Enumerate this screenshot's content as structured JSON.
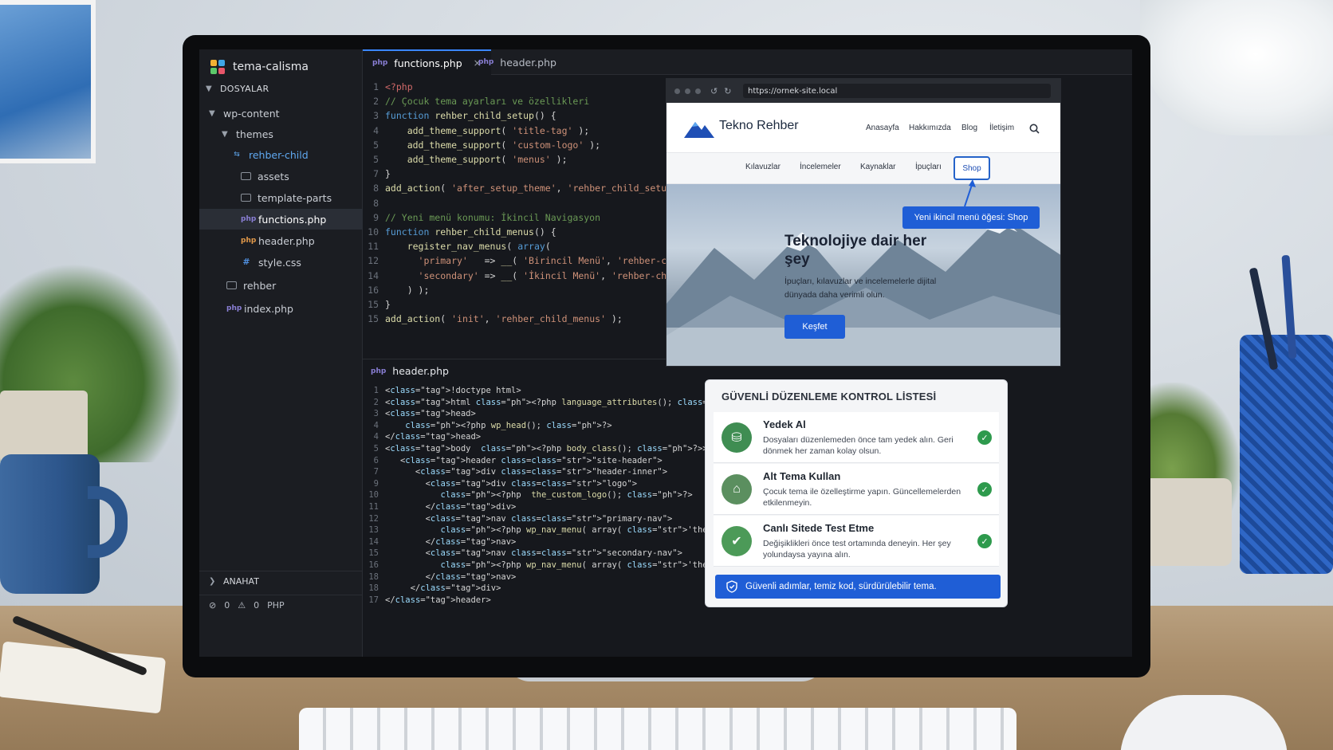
{
  "workspace": {
    "name": "tema-calisma"
  },
  "explorer": {
    "section": "DOSYALAR",
    "tree": [
      {
        "label": "wp-content"
      },
      {
        "label": "themes"
      },
      {
        "label": "rehber-child"
      },
      {
        "label": "assets"
      },
      {
        "label": "template-parts"
      },
      {
        "label": "functions.php"
      },
      {
        "label": "header.php"
      },
      {
        "label": "style.css"
      },
      {
        "label": "rehber"
      },
      {
        "label": "index.php"
      }
    ],
    "outline": "ANAHAT",
    "status": {
      "errors": "0",
      "warnings": "0",
      "language": "PHP"
    }
  },
  "tabs": [
    {
      "label": "functions.php",
      "close": "×"
    },
    {
      "label": "header.php"
    }
  ],
  "functions_php": [
    {
      "n": "1",
      "t": "<?php"
    },
    {
      "n": "2",
      "t": "// Çocuk tema ayarları ve özellikleri"
    },
    {
      "n": "3",
      "t": "function rehber_child_setup() {"
    },
    {
      "n": "4",
      "t": "    add_theme_support( 'title-tag' );"
    },
    {
      "n": "5",
      "t": "    add_theme_support( 'custom-logo' );"
    },
    {
      "n": "5",
      "t": "    add_theme_support( 'menus' );"
    },
    {
      "n": "7",
      "t": "}"
    },
    {
      "n": "8",
      "t": "add_action( 'after_setup_theme', 'rehber_child_setup' );"
    },
    {
      "n": "8",
      "t": ""
    },
    {
      "n": "9",
      "t": "// Yeni menü konumu: İkincil Navigasyon"
    },
    {
      "n": "10",
      "t": "function rehber_child_menus() {"
    },
    {
      "n": "11",
      "t": "    register_nav_menus( array("
    },
    {
      "n": "12",
      "t": "      'primary'   => __( 'Birincil Menü', 'rehber-child' ),"
    },
    {
      "n": "14",
      "t": "      'secondary' => __( 'İkincil Menü', 'rehber-child' ),"
    },
    {
      "n": "16",
      "t": "    ) );"
    },
    {
      "n": "15",
      "t": "}"
    },
    {
      "n": "15",
      "t": "add_action( 'init', 'rehber_child_menus' );"
    }
  ],
  "header_panel_title": "header.php",
  "header_php": [
    {
      "n": "1",
      "t": "<!doctype html>"
    },
    {
      "n": "2",
      "t": "<html <?php language_attributes(); ?>>"
    },
    {
      "n": "3",
      "t": "<head>"
    },
    {
      "n": "4",
      "t": "    <?php wp_head(); ?>"
    },
    {
      "n": "4",
      "t": "</head>"
    },
    {
      "n": "5",
      "t": "<body  <?php body_class(); ?>>"
    },
    {
      "n": "6",
      "t": "   <header class=\"site-header\">"
    },
    {
      "n": "7",
      "t": "      <div class=\"header-inner\">"
    },
    {
      "n": "9",
      "t": "        <div class=\"logo\">"
    },
    {
      "n": "10",
      "t": "           <?php  the_custom_logo(); ?>"
    },
    {
      "n": "11",
      "t": "        </div>"
    },
    {
      "n": "12",
      "t": "        <nav class=\"primary-nav\">"
    },
    {
      "n": "13",
      "t": "           <?php wp_nav_menu( array( 'theme_location' => 'primary' ) ); ?>"
    },
    {
      "n": "14",
      "t": "        </nav>"
    },
    {
      "n": "15",
      "t": "        <nav class=\"secondary-nav\">"
    },
    {
      "n": "16",
      "t": "           <?php wp_nav_menu( array( 'theme_location' => 'secondary' ) ); ?>"
    },
    {
      "n": "18",
      "t": "        </nav>"
    },
    {
      "n": "18",
      "t": "     </div>"
    },
    {
      "n": "17",
      "t": "</header>"
    }
  ],
  "browser": {
    "url": "https://ornek-site.local",
    "site_name": "Tekno Rehber",
    "primary_nav": [
      "Anasayfa",
      "Hakkımızda",
      "Blog",
      "İletişim"
    ],
    "secondary_nav": [
      "Kılavuzlar",
      "İncelemeler",
      "Kaynaklar",
      "İpuçları",
      "Shop"
    ],
    "callout": "Yeni ikincil menü öğesi: Shop",
    "hero_title": "Teknolojiye dair her şey",
    "hero_text": "İpuçları, kılavuzlar ve incelemelerle dijital dünyada daha verimli olun.",
    "hero_button": "Keşfet"
  },
  "checklist": {
    "title": "GÜVENLİ DÜZENLEME KONTROL LİSTESİ",
    "items": [
      {
        "title": "Yedek Al",
        "desc": "Dosyaları düzenlemeden önce tam yedek alın. Geri dönmek her zaman kolay olsun."
      },
      {
        "title": "Alt Tema Kullan",
        "desc": "Çocuk tema ile özelleştirme yapın. Güncellemelerden etkilenmeyin."
      },
      {
        "title": "Canlı Sitede Test Etme",
        "desc": "Değişiklikleri önce test ortamında deneyin. Her şey yolundaysa yayına alın."
      }
    ],
    "banner": "Güvenli adımlar, temiz kod, sürdürülebilir tema."
  },
  "colors": {
    "accent": "#1f5ed6",
    "editor_bg": "#16181d",
    "check": "#2e9a4d"
  }
}
